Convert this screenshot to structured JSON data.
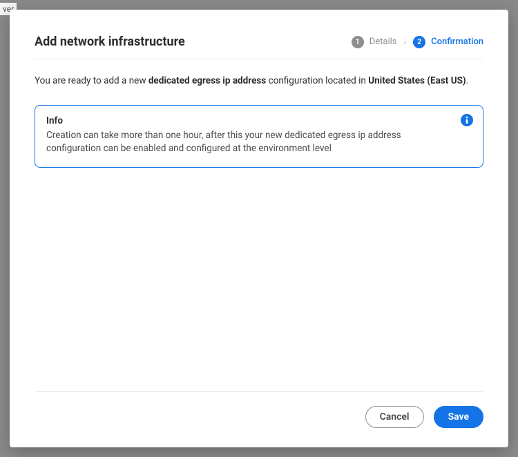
{
  "bg_fragment": "ver",
  "dialog": {
    "title": "Add network infrastructure",
    "steps": {
      "one": {
        "num": "1",
        "label": "Details"
      },
      "two": {
        "num": "2",
        "label": "Confirmation"
      }
    },
    "intro": {
      "prefix": "You are ready to add a new ",
      "config_type": "dedicated egress ip address",
      "middle": " configuration located in ",
      "region": "United States (East US)",
      "suffix": "."
    },
    "info": {
      "title": "Info",
      "body": "Creation can take more than one hour, after this your new dedicated egress ip address configuration can be enabled and configured at the environment level"
    },
    "actions": {
      "cancel": "Cancel",
      "save": "Save"
    }
  },
  "colors": {
    "primary": "#1473e6",
    "muted": "#8e8e8e"
  }
}
